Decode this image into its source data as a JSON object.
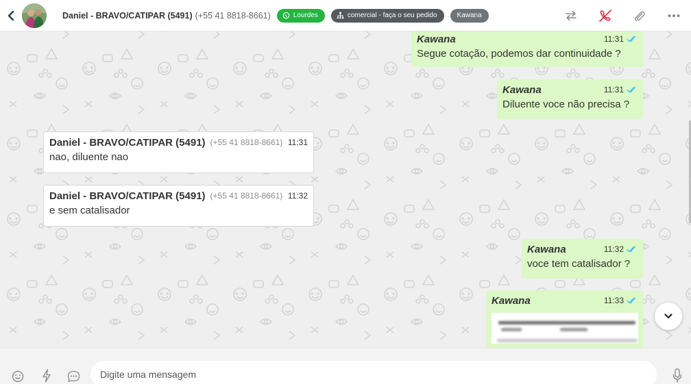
{
  "header": {
    "contact_name": "Daniel - BRAVO/CATIPAR (5491)",
    "contact_phone": "(+55 41 8818-8661)",
    "badges": [
      {
        "label": "Lourdes",
        "icon": "whatsapp-icon",
        "color": "#25b440"
      },
      {
        "label": "comercial - faça o seu pedido",
        "icon": "sitemap-icon",
        "color": "#555a5e"
      },
      {
        "label": "Kawana",
        "color": "#6e7479"
      }
    ],
    "actions": [
      "transfer-icon",
      "phone-off-icon",
      "paperclip-icon",
      "more-icon"
    ]
  },
  "messages": [
    {
      "direction": "out",
      "sender": "Kawana",
      "time": "11:31",
      "text": "Segue cotação, podemos dar continuidade ?",
      "status": "read"
    },
    {
      "direction": "out",
      "sender": "Kawana",
      "time": "11:31",
      "text": "Diluente voce não precisa ?",
      "status": "read"
    },
    {
      "direction": "in",
      "sender": "Daniel - BRAVO/CATIPAR (5491)",
      "phone": "(+55 41 8818-8661)",
      "time": "11:31",
      "text": "nao, diluente nao"
    },
    {
      "direction": "in",
      "sender": "Daniel - BRAVO/CATIPAR (5491)",
      "phone": "(+55 41 8818-8661)",
      "time": "11:32",
      "text": "e sem catalisador"
    },
    {
      "direction": "out",
      "sender": "Kawana",
      "time": "11:32",
      "text": "voce tem catalisador ?",
      "status": "read"
    },
    {
      "direction": "out",
      "sender": "Kawana",
      "time": "11:33",
      "text": "",
      "attachment": "image",
      "status": "read"
    }
  ],
  "composer": {
    "placeholder": "Digite uma mensagem",
    "value": ""
  },
  "colors": {
    "outgoing_bubble": "#dcf8c6",
    "incoming_bubble": "#ffffff",
    "read_tick": "#4fc3f7",
    "hangup_red": "#d9283c",
    "whatsapp_green": "#25b440"
  }
}
